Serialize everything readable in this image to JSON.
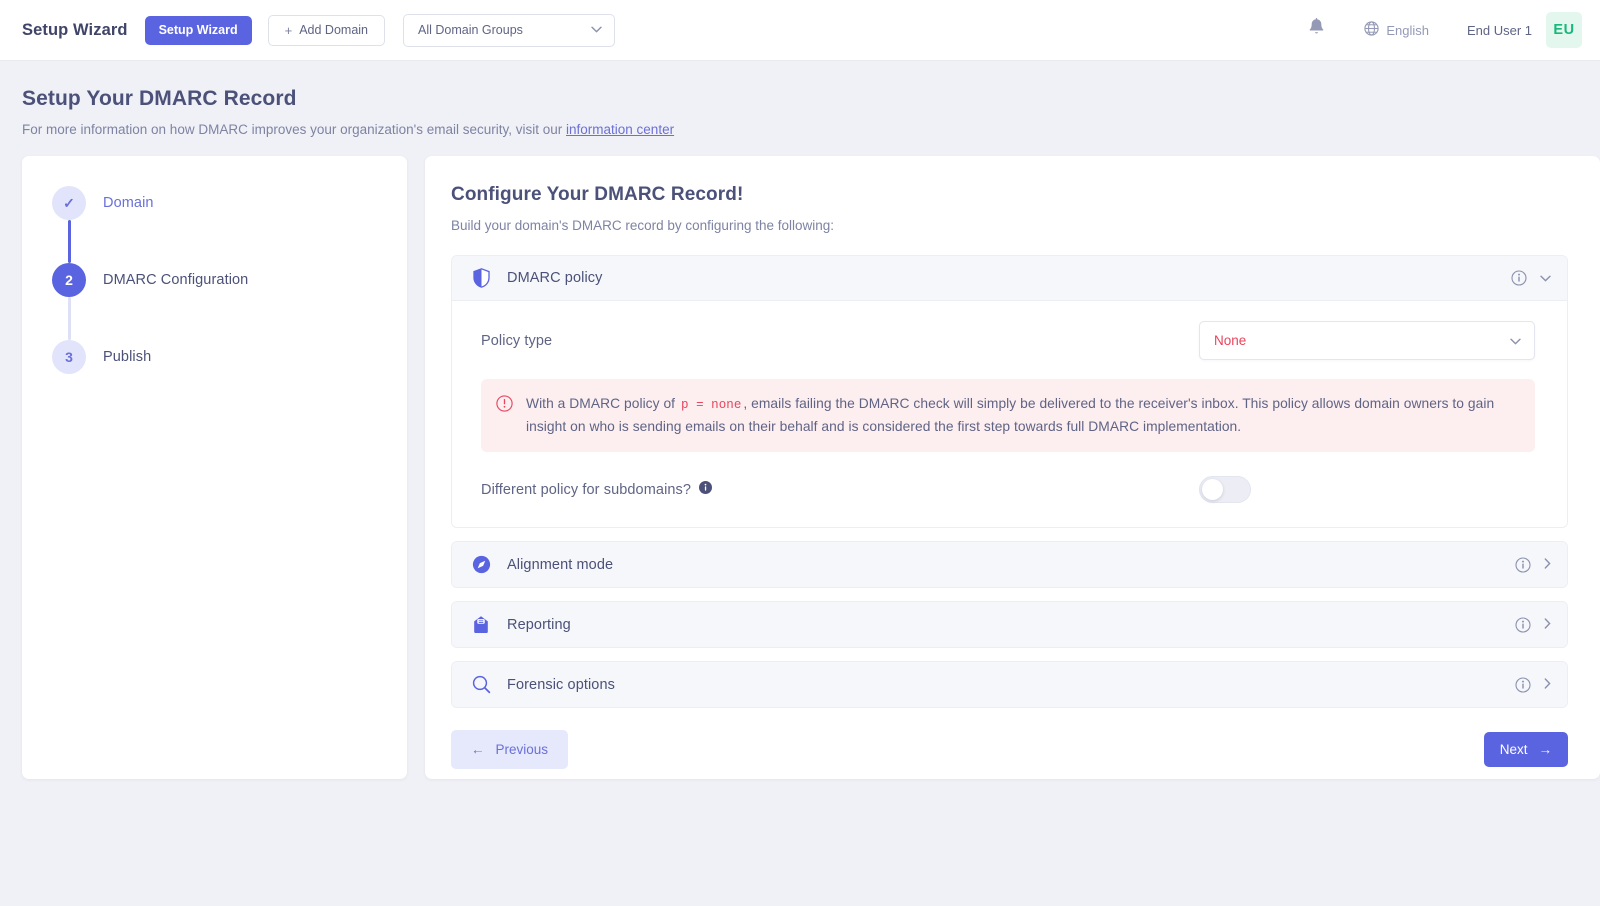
{
  "topbar": {
    "brand": "Setup Wizard",
    "setup_wizard_button": "Setup Wizard",
    "add_domain_button": "Add Domain",
    "add_domain_plus": "+",
    "domain_group_select": "All Domain Groups",
    "notifications_icon": "bell-icon",
    "language_icon": "globe-icon",
    "language": "English",
    "user_name": "End User 1",
    "avatar_initials": "EU"
  },
  "page": {
    "title": "Setup Your DMARC Record",
    "subtitle_before": "For more information on how DMARC improves your organization's email security, visit our ",
    "subtitle_link": "information center"
  },
  "stepper": {
    "steps": [
      {
        "marker": "✓",
        "label": "Domain",
        "state": "done"
      },
      {
        "marker": "2",
        "label": "DMARC Configuration",
        "state": "active"
      },
      {
        "marker": "3",
        "label": "Publish",
        "state": "todo"
      }
    ]
  },
  "main": {
    "title": "Configure Your DMARC Record!",
    "subtitle": "Build your domain's DMARC record by configuring the following:",
    "panels": [
      {
        "icon": "shield-icon",
        "title": "DMARC policy",
        "info_icon": "info-circle-icon",
        "chevron": "⌄",
        "expanded": true
      },
      {
        "icon": "compass-icon",
        "title": "Alignment mode",
        "info_icon": "info-circle-icon",
        "chevron": "›",
        "expanded": false
      },
      {
        "icon": "inbox-icon",
        "title": "Reporting",
        "info_icon": "info-circle-icon",
        "chevron": "›",
        "expanded": false
      },
      {
        "icon": "search-icon",
        "title": "Forensic options",
        "info_icon": "info-circle-icon",
        "chevron": "›",
        "expanded": false
      }
    ],
    "policy": {
      "label": "Policy type",
      "value": "None",
      "chevron": "⌄",
      "alert_icon": "alert-circle-icon",
      "alert_part1": "With a DMARC policy of",
      "alert_code": "p = none",
      "alert_part2": ", emails failing the DMARC check will simply be delivered to the receiver's inbox. This policy allows domain owners to gain insight on who is sending emails on their behalf and is considered the first step towards full DMARC implementation.",
      "subdomain_label": "Different policy for subdomains?",
      "subdomain_info_icon": "info-filled-icon",
      "subdomain_toggle_on": false
    },
    "footer": {
      "previous_label": "Previous",
      "previous_arrow": "←",
      "next_label": "Next",
      "next_arrow": "→"
    }
  },
  "colors": {
    "accent": "#5a63e0",
    "accent_light": "#e6e8fb",
    "danger": "#e8455e",
    "danger_bg": "#fdeef0",
    "text": "#4b5178",
    "muted": "#7e83a3",
    "page_bg": "#f0f1f6",
    "avatar_bg": "#e4f7ee",
    "avatar_fg": "#17b87b"
  }
}
